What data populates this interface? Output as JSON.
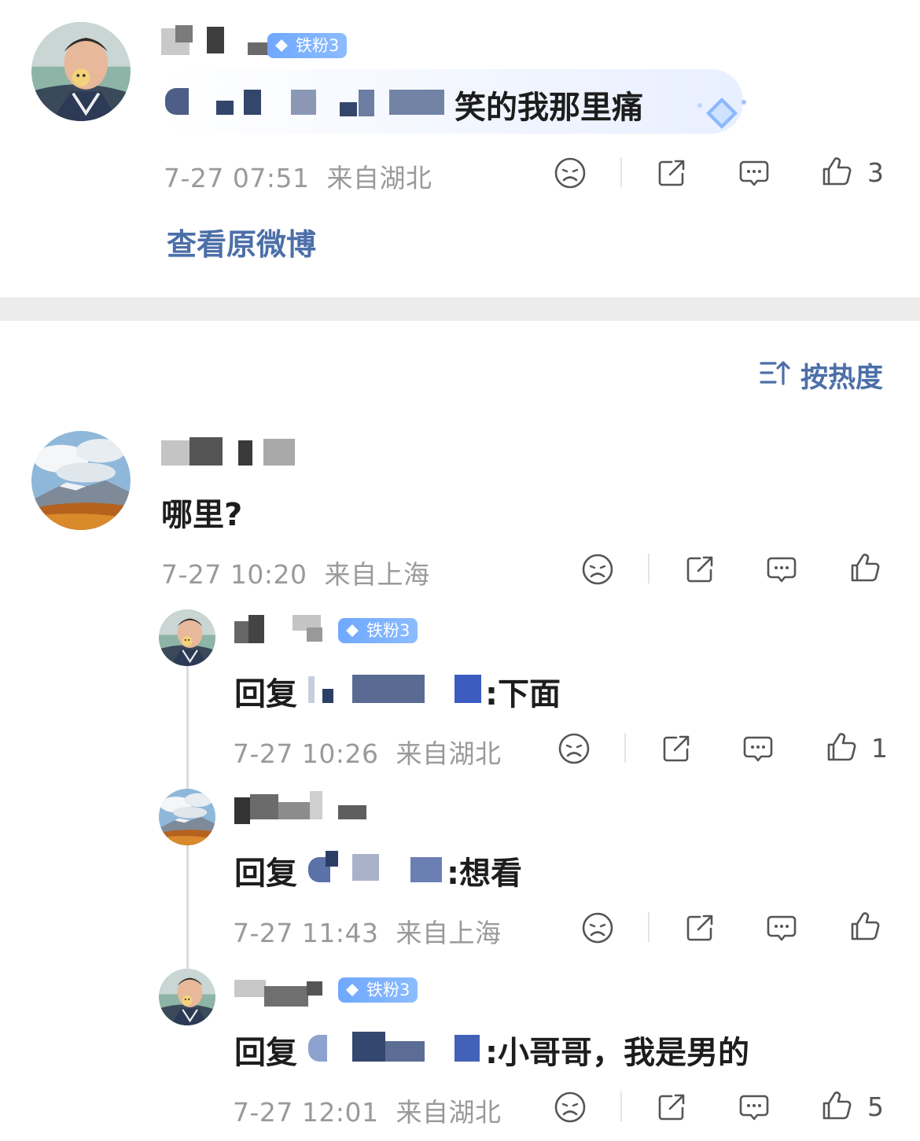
{
  "comment_top": {
    "badge": "铁粉3",
    "text": "笑的我那里痛",
    "time": "7-27 07:51",
    "location": "来自湖北",
    "like_count": "3",
    "view_original": "查看原微博"
  },
  "sort": {
    "label": "按热度"
  },
  "comment_main": {
    "text": "哪里?",
    "time": "7-27 10:20",
    "location": "来自上海",
    "like_count": ""
  },
  "replies": [
    {
      "badge": "铁粉3",
      "prefix": "回复",
      "suffix": ":下面",
      "time": "7-27 10:26",
      "location": "来自湖北",
      "like_count": "1"
    },
    {
      "badge": "",
      "prefix": "回复",
      "suffix": ":想看",
      "time": "7-27 11:43",
      "location": "来自上海",
      "like_count": ""
    },
    {
      "badge": "铁粉3",
      "prefix": "回复",
      "suffix": ":小哥哥，我是男的",
      "time": "7-27 12:01",
      "location": "来自湖北",
      "like_count": "5"
    }
  ],
  "colors": {
    "link": "#4c6fa8",
    "badge": "#7ab0ff",
    "meta": "#9a9a9a",
    "divider": "#ececec"
  },
  "icons": [
    "frown-icon",
    "share-icon",
    "comment-icon",
    "like-icon",
    "sort-icon",
    "gem-icon"
  ]
}
